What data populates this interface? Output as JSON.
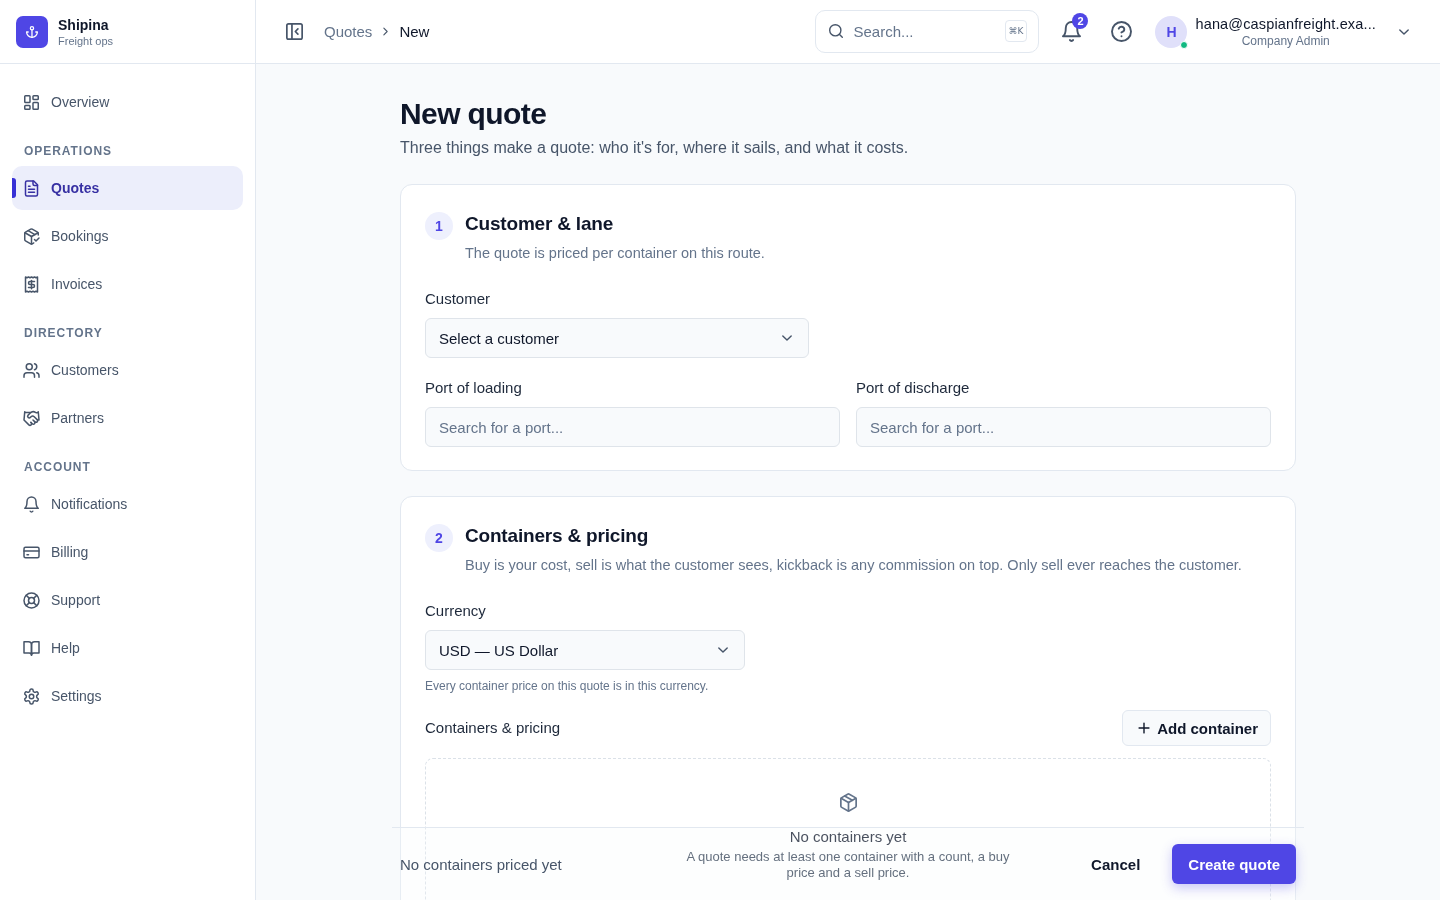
{
  "brand": {
    "name": "Shipina",
    "tagline": "Freight ops"
  },
  "sidebar": {
    "sections": [
      {
        "items": [
          {
            "label": "Overview",
            "selected": false
          }
        ]
      },
      {
        "title": "OPERATIONS",
        "items": [
          {
            "label": "Quotes",
            "selected": true
          },
          {
            "label": "Bookings",
            "selected": false
          },
          {
            "label": "Invoices",
            "selected": false
          }
        ]
      },
      {
        "title": "DIRECTORY",
        "items": [
          {
            "label": "Customers",
            "selected": false
          },
          {
            "label": "Partners",
            "selected": false
          }
        ]
      },
      {
        "title": "ACCOUNT",
        "items": [
          {
            "label": "Notifications",
            "selected": false
          },
          {
            "label": "Billing",
            "selected": false
          },
          {
            "label": "Support",
            "selected": false
          },
          {
            "label": "Help",
            "selected": false
          },
          {
            "label": "Settings",
            "selected": false
          }
        ]
      }
    ]
  },
  "header": {
    "breadcrumb": [
      "Quotes",
      "New"
    ],
    "search": {
      "placeholder": "Search...",
      "shortcut": "⌘K"
    },
    "notifications": {
      "count": "2"
    },
    "user": {
      "initial": "H",
      "email": "hana@caspianfreight.exa...",
      "role": "Company Admin",
      "online": true
    }
  },
  "page": {
    "title": "New quote",
    "subtitle": "Three things make a quote: who it's for, where it sails, and what it costs."
  },
  "sections": [
    {
      "number": "1",
      "title": "Customer & lane",
      "description": "The quote is priced per container on this route.",
      "customer": {
        "label": "Customer",
        "value": "Select a customer"
      },
      "ports": [
        {
          "label": "Port of loading",
          "placeholder": "Search for a port..."
        },
        {
          "label": "Port of discharge",
          "placeholder": "Search for a port..."
        }
      ]
    },
    {
      "number": "2",
      "title": "Containers & pricing",
      "description": "Buy is your cost, sell is what the customer sees, kickback is any commission on top. Only sell ever reaches the customer.",
      "currency": {
        "label": "Currency",
        "value": "USD — US Dollar",
        "hint": "Every container price on this quote is in this currency."
      },
      "containers": {
        "label": "Containers & pricing",
        "button": "Add container",
        "empty": {
          "title": "No containers yet",
          "text": "A quote needs at least one container with a count, a buy price and a sell price."
        }
      }
    }
  ],
  "footer": {
    "status": "No containers priced yet",
    "buttons": [
      {
        "label": "Cancel",
        "kind": "secondary"
      },
      {
        "label": "Create quote",
        "kind": "primary"
      }
    ]
  }
}
